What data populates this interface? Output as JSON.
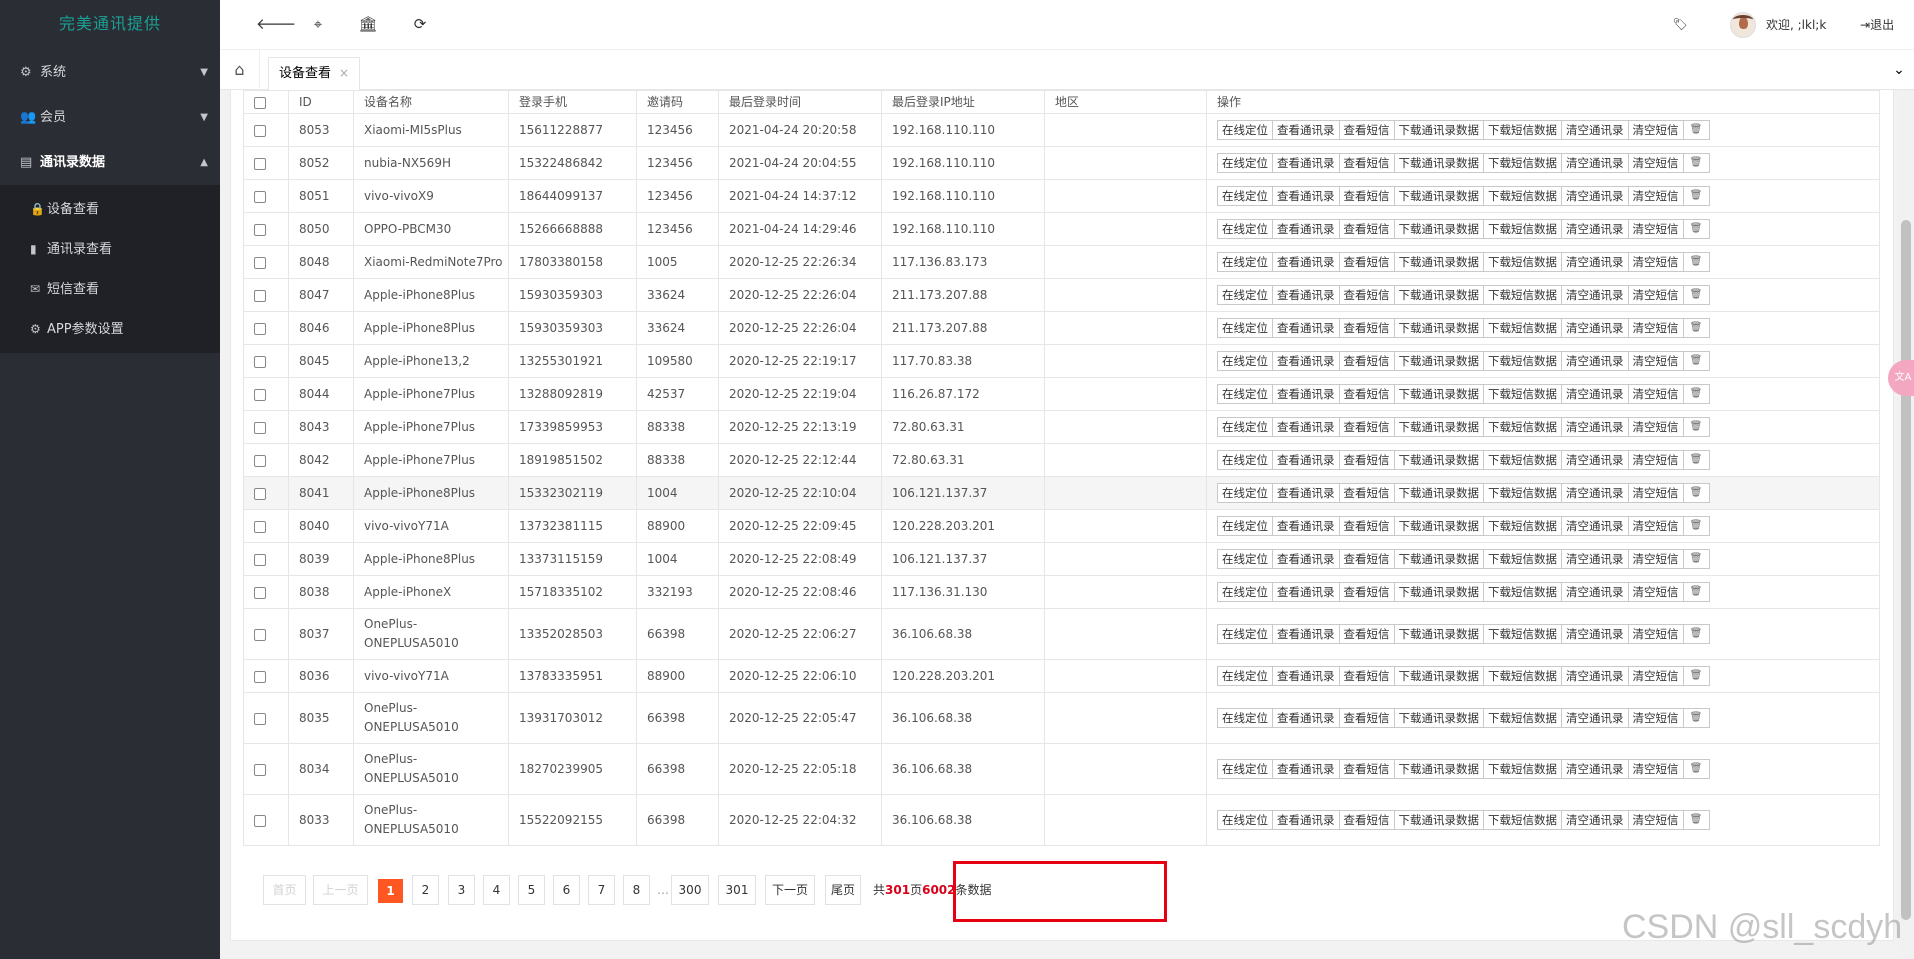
{
  "sidebar": {
    "brand": "完美通讯提供",
    "menu": [
      {
        "label": "系统",
        "icon": "gear-icon"
      },
      {
        "label": "会员",
        "icon": "users-icon"
      },
      {
        "label": "通讯录数据",
        "icon": "id-card-icon"
      }
    ],
    "submenu": [
      {
        "label": "设备查看",
        "icon": "lock-icon"
      },
      {
        "label": "通讯录查看",
        "icon": "book-icon"
      },
      {
        "label": "短信查看",
        "icon": "envelope-icon"
      },
      {
        "label": "APP参数设置",
        "icon": "gear-icon"
      }
    ]
  },
  "topbar": {
    "welcome": "欢迎, ;lkl;k",
    "logout": "退出"
  },
  "tabs": {
    "active_label": "设备查看",
    "close": "×"
  },
  "table": {
    "headers": [
      "ID",
      "设备名称",
      "登录手机",
      "邀请码",
      "最后登录时间",
      "最后登录IP地址",
      "地区",
      "操作"
    ],
    "actions": [
      "在线定位",
      "查看通讯录",
      "查看短信",
      "下载通讯录数据",
      "下载短信数据",
      "清空通讯录",
      "清空短信"
    ],
    "rows": [
      {
        "id": "8053",
        "device": "Xiaomi-MI5sPlus",
        "phone": "15611228877",
        "code": "123456",
        "time": "2021-04-24 20:20:58",
        "ip": "192.168.110.110"
      },
      {
        "id": "8052",
        "device": "nubia-NX569H",
        "phone": "15322486842",
        "code": "123456",
        "time": "2021-04-24 20:04:55",
        "ip": "192.168.110.110"
      },
      {
        "id": "8051",
        "device": "vivo-vivoX9",
        "phone": "18644099137",
        "code": "123456",
        "time": "2021-04-24 14:37:12",
        "ip": "192.168.110.110"
      },
      {
        "id": "8050",
        "device": "OPPO-PBCM30",
        "phone": "15266668888",
        "code": "123456",
        "time": "2021-04-24 14:29:46",
        "ip": "192.168.110.110"
      },
      {
        "id": "8048",
        "device": "Xiaomi-RedmiNote7Pro",
        "phone": "17803380158",
        "code": "1005",
        "time": "2020-12-25 22:26:34",
        "ip": "117.136.83.173"
      },
      {
        "id": "8047",
        "device": "Apple-iPhone8Plus",
        "phone": "15930359303",
        "code": "33624",
        "time": "2020-12-25 22:26:04",
        "ip": "211.173.207.88"
      },
      {
        "id": "8046",
        "device": "Apple-iPhone8Plus",
        "phone": "15930359303",
        "code": "33624",
        "time": "2020-12-25 22:26:04",
        "ip": "211.173.207.88"
      },
      {
        "id": "8045",
        "device": "Apple-iPhone13,2",
        "phone": "13255301921",
        "code": "109580",
        "time": "2020-12-25 22:19:17",
        "ip": "117.70.83.38"
      },
      {
        "id": "8044",
        "device": "Apple-iPhone7Plus",
        "phone": "13288092819",
        "code": "42537",
        "time": "2020-12-25 22:19:04",
        "ip": "116.26.87.172"
      },
      {
        "id": "8043",
        "device": "Apple-iPhone7Plus",
        "phone": "17339859953",
        "code": "88338",
        "time": "2020-12-25 22:13:19",
        "ip": "72.80.63.31"
      },
      {
        "id": "8042",
        "device": "Apple-iPhone7Plus",
        "phone": "18919851502",
        "code": "88338",
        "time": "2020-12-25 22:12:44",
        "ip": "72.80.63.31"
      },
      {
        "id": "8041",
        "device": "Apple-iPhone8Plus",
        "phone": "15332302119",
        "code": "1004",
        "time": "2020-12-25 22:10:04",
        "ip": "106.121.137.37"
      },
      {
        "id": "8040",
        "device": "vivo-vivoY71A",
        "phone": "13732381115",
        "code": "88900",
        "time": "2020-12-25 22:09:45",
        "ip": "120.228.203.201"
      },
      {
        "id": "8039",
        "device": "Apple-iPhone8Plus",
        "phone": "13373115159",
        "code": "1004",
        "time": "2020-12-25 22:08:49",
        "ip": "106.121.137.37"
      },
      {
        "id": "8038",
        "device": "Apple-iPhoneX",
        "phone": "15718335102",
        "code": "332193",
        "time": "2020-12-25 22:08:46",
        "ip": "117.136.31.130"
      },
      {
        "id": "8037",
        "device": "OnePlus-ONEPLUSA5010",
        "phone": "13352028503",
        "code": "66398",
        "time": "2020-12-25 22:06:27",
        "ip": "36.106.68.38"
      },
      {
        "id": "8036",
        "device": "vivo-vivoY71A",
        "phone": "13783335951",
        "code": "88900",
        "time": "2020-12-25 22:06:10",
        "ip": "120.228.203.201"
      },
      {
        "id": "8035",
        "device": "OnePlus-ONEPLUSA5010",
        "phone": "13931703012",
        "code": "66398",
        "time": "2020-12-25 22:05:47",
        "ip": "36.106.68.38"
      },
      {
        "id": "8034",
        "device": "OnePlus-ONEPLUSA5010",
        "phone": "18270239905",
        "code": "66398",
        "time": "2020-12-25 22:05:18",
        "ip": "36.106.68.38"
      },
      {
        "id": "8033",
        "device": "OnePlus-ONEPLUSA5010",
        "phone": "15522092155",
        "code": "66398",
        "time": "2020-12-25 22:04:32",
        "ip": "36.106.68.38"
      }
    ]
  },
  "pagination": {
    "first": "首页",
    "prev": "上一页",
    "pages": [
      "1",
      "2",
      "3",
      "4",
      "5",
      "6",
      "7",
      "8"
    ],
    "ellipsis": "…",
    "tail_pages": [
      "300",
      "301"
    ],
    "next": "下一页",
    "last": "尾页",
    "total_prefix": "共",
    "total_pages": "301",
    "total_mid": "页",
    "total_records": "6002",
    "total_suffix": "条数据"
  },
  "watermark": "CSDN @sll_scdyh",
  "colors": {
    "sidebar_bg": "#2a2d33",
    "brand": "#1aa094",
    "active_page": "#ff5722",
    "highlight": "#e60012"
  }
}
